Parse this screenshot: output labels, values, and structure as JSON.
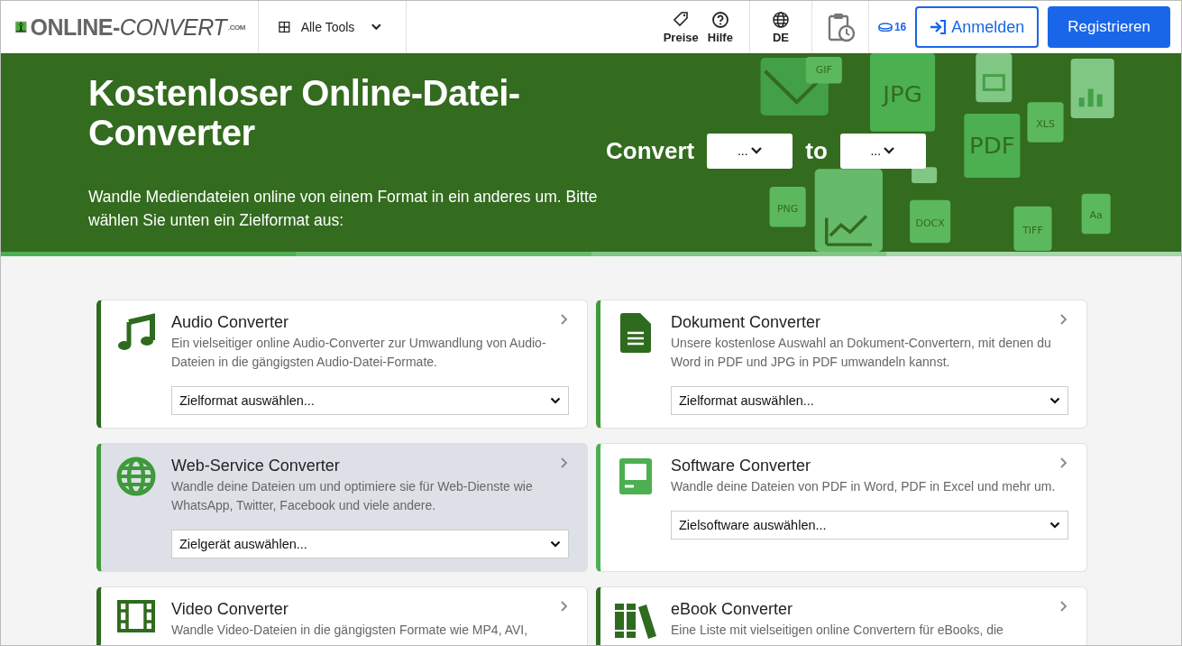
{
  "header": {
    "logo": {
      "text_main": "ONLINE-",
      "text_accent": "CONVERT",
      "text_suffix": ".COM"
    },
    "tools_menu": {
      "label": "Alle Tools"
    },
    "nav": [
      {
        "label": "Preise",
        "kind": "tag"
      },
      {
        "label": "Hilfe",
        "kind": "help"
      }
    ],
    "language": "DE",
    "credits": "16",
    "login": "Anmelden",
    "register": "Registrieren"
  },
  "hero": {
    "title": "Kostenloser Online-Datei-Converter",
    "subtitle": "Wandle Mediendateien online von einem Format in ein anderes um. Bitte wählen Sie unten ein Zielformat aus:",
    "convert_label": "Convert",
    "from_value": "...",
    "to_label": "to",
    "to_value": "...",
    "file_badges": [
      "GIF",
      "JPG",
      "XLS",
      "PDF",
      "PNG",
      "DOCX",
      "TIFF",
      "Aa"
    ]
  },
  "cards": [
    {
      "title": "Audio Converter",
      "kind": "music",
      "color": "#2f6b1e",
      "selected": false,
      "description": "Ein vielseitiger online Audio-Converter zur Umwandlung von Audio-Dateien in die gängigsten Audio-Datei-Formate.",
      "select_placeholder": "Zielformat auswählen..."
    },
    {
      "title": "Dokument Converter",
      "kind": "document",
      "color": "#3e9a3a",
      "selected": false,
      "description": "Unsere kostenlose Auswahl an Dokument-Convertern, mit denen du Word in PDF und JPG in PDF umwandeln kannst.",
      "select_placeholder": "Zielformat auswählen..."
    },
    {
      "title": "Web-Service Converter",
      "kind": "globe",
      "color": "#3e9a3a",
      "selected": true,
      "description": "Wandle deine Dateien um und optimiere sie für Web-Dienste wie WhatsApp, Twitter, Facebook und viele andere.",
      "select_placeholder": "Zielgerät auswählen..."
    },
    {
      "title": "Software Converter",
      "kind": "monitor",
      "color": "#4caf50",
      "selected": false,
      "description": "Wandle deine Dateien von PDF in Word, PDF in Excel und mehr um.",
      "select_placeholder": "Zielsoftware auswählen..."
    },
    {
      "title": "Video Converter",
      "kind": "film",
      "color": "#2f6b1e",
      "selected": false,
      "description": "Wandle Video-Dateien in die gängigsten Formate wie MP4, AVI,"
    },
    {
      "title": "eBook Converter",
      "kind": "books",
      "color": "#2f6b1e",
      "selected": false,
      "description": "Eine Liste mit vielseitigen online Convertern für eBooks, die"
    }
  ]
}
